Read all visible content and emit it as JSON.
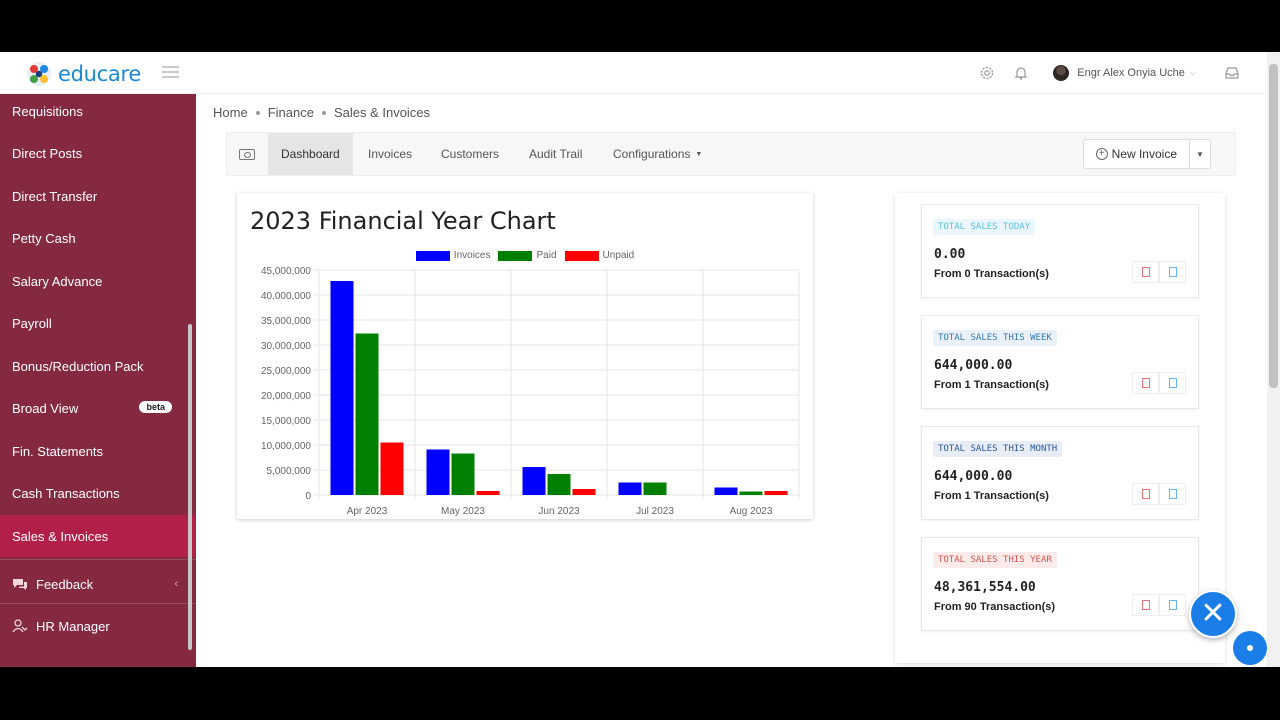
{
  "app": {
    "logo_text": "educare"
  },
  "header": {
    "user_name": "Engr Alex Onyia Uche"
  },
  "sidebar": {
    "items": [
      {
        "label": "Requisitions",
        "name": "sidebar-item-requisitions"
      },
      {
        "label": "Direct Posts",
        "name": "sidebar-item-direct-posts"
      },
      {
        "label": "Direct Transfer",
        "name": "sidebar-item-direct-transfer"
      },
      {
        "label": "Petty Cash",
        "name": "sidebar-item-petty-cash"
      },
      {
        "label": "Salary Advance",
        "name": "sidebar-item-salary-advance"
      },
      {
        "label": "Payroll",
        "name": "sidebar-item-payroll"
      },
      {
        "label": "Bonus/Reduction Pack",
        "name": "sidebar-item-bonus-reduction"
      },
      {
        "label": "Broad View",
        "name": "sidebar-item-broad-view",
        "badge": "beta"
      },
      {
        "label": "Fin. Statements",
        "name": "sidebar-item-fin-statements"
      },
      {
        "label": "Cash Transactions",
        "name": "sidebar-item-cash-transactions"
      },
      {
        "label": "Sales & Invoices",
        "name": "sidebar-item-sales-invoices",
        "active": true
      }
    ],
    "sections": [
      {
        "label": "Feedback",
        "icon": "chat-icon"
      },
      {
        "label": "HR Manager",
        "icon": "users-icon"
      }
    ]
  },
  "breadcrumb": [
    "Home",
    "Finance",
    "Sales & Invoices"
  ],
  "tabs": [
    "Dashboard",
    "Invoices",
    "Customers",
    "Audit Trail",
    "Configurations"
  ],
  "new_invoice_label": "New Invoice",
  "chart_data": {
    "type": "bar",
    "title": "2023 Financial Year Chart",
    "categories": [
      "Apr 2023",
      "May 2023",
      "Jun 2023",
      "Jul 2023",
      "Aug 2023"
    ],
    "series": [
      {
        "name": "Invoices",
        "color": "#0000ff",
        "values": [
          42800000,
          9100000,
          5600000,
          2500000,
          1500000
        ]
      },
      {
        "name": "Paid",
        "color": "#008000",
        "values": [
          32300000,
          8300000,
          4200000,
          2500000,
          700000
        ]
      },
      {
        "name": "Unpaid",
        "color": "#ff0000",
        "values": [
          10500000,
          800000,
          1200000,
          0,
          800000
        ]
      }
    ],
    "ylim": [
      0,
      45000000
    ],
    "yticks": [
      "45,000,000",
      "40,000,000",
      "35,000,000",
      "30,000,000",
      "25,000,000",
      "20,000,000",
      "15,000,000",
      "10,000,000",
      "5,000,000",
      "0"
    ],
    "grid": true,
    "legend": "top"
  },
  "stats": [
    {
      "badge": "TOTAL SALES TODAY",
      "value": "0.00",
      "sub": "From 0 Transaction(s)",
      "badge_color": "#5bc0de",
      "badge_bg": "#eaf6fb"
    },
    {
      "badge": "TOTAL SALES THIS WEEK",
      "value": "644,000.00",
      "sub": "From 1 Transaction(s)",
      "badge_color": "#337ab7",
      "badge_bg": "#eaf0f7"
    },
    {
      "badge": "TOTAL SALES THIS MONTH",
      "value": "644,000.00",
      "sub": "From 1 Transaction(s)",
      "badge_color": "#2b5a9b",
      "badge_bg": "#e8edf5"
    },
    {
      "badge": "TOTAL SALES THIS YEAR",
      "value": "48,361,554.00",
      "sub": "From 90 Transaction(s)",
      "badge_color": "#d9534f",
      "badge_bg": "#fbeceb"
    }
  ]
}
